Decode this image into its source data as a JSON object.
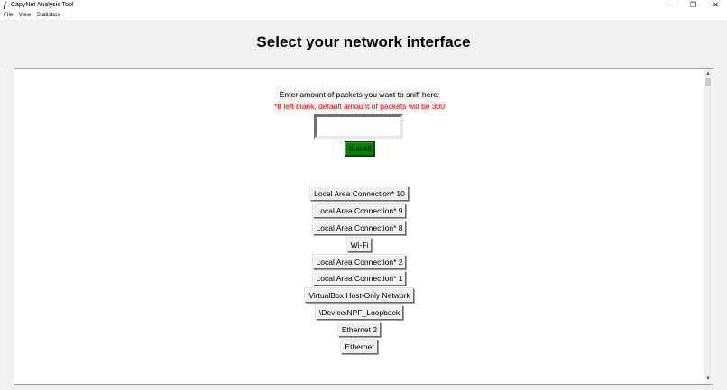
{
  "window": {
    "title": "CapyNet Analysis Tool",
    "minimize_glyph": "—",
    "restore_glyph": "❐",
    "close_glyph": "✕"
  },
  "menu": {
    "items": [
      "File",
      "View",
      "Statistics"
    ]
  },
  "header": {
    "title": "Select your network interface"
  },
  "sniff_form": {
    "prompt": "Enter amount of packets you want to sniff here:",
    "default_note": "*If left blank, default amount of packets will be 300",
    "input_value": "",
    "submit_label": "Submit",
    "submit_color": "#008000",
    "note_color": "#ff0000"
  },
  "interfaces": [
    "Local Area Connection* 10",
    "Local Area Connection* 9",
    "Local Area Connection* 8",
    "Wi-Fi",
    "Local Area Connection* 2",
    "Local Area Connection* 1",
    "VirtualBox Host-Only Network",
    "\\Device\\NPF_Loopback",
    "Ethernet 2",
    "Ethernet"
  ],
  "icons": {
    "app": "feather-icon",
    "scroll_up": "chevron-up-icon",
    "scroll_down": "chevron-down-icon"
  }
}
